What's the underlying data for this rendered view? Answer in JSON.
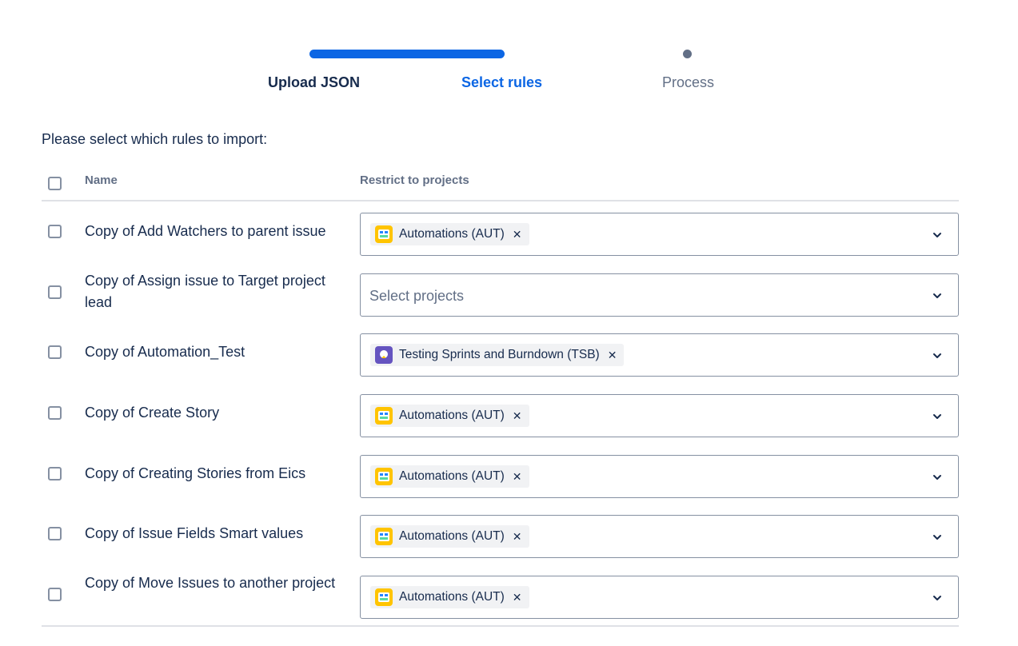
{
  "tracker": {
    "steps": [
      {
        "label": "Upload JSON",
        "state": "complete"
      },
      {
        "label": "Select rules",
        "state": "current"
      },
      {
        "label": "Process",
        "state": "upcoming"
      }
    ],
    "accent_color": "#0c66e4",
    "pending_color": "#626f86"
  },
  "instruction": "Please select which rules to import:",
  "table": {
    "headers": {
      "name": "Name",
      "restrict": "Restrict to projects"
    },
    "select_all_checked": false,
    "placeholder": "Select projects",
    "rows": [
      {
        "name": "Copy of Add Watchers to parent issue",
        "checked": false,
        "project": "Automations (AUT)",
        "project_icon": "automations-avatar-icon"
      },
      {
        "name": "Copy of Assign issue to Target project lead",
        "checked": false,
        "project": null,
        "project_icon": null
      },
      {
        "name": "Copy of Automation_Test",
        "checked": false,
        "project": "Testing Sprints and Burndown (TSB)",
        "project_icon": "tsb-avatar-icon"
      },
      {
        "name": "Copy of Create Story",
        "checked": false,
        "project": "Automations (AUT)",
        "project_icon": "automations-avatar-icon"
      },
      {
        "name": "Copy of Creating Stories from Eics",
        "checked": false,
        "project": "Automations (AUT)",
        "project_icon": "automations-avatar-icon"
      },
      {
        "name": "Copy of Issue Fields Smart values",
        "checked": false,
        "project": "Automations (AUT)",
        "project_icon": "automations-avatar-icon"
      },
      {
        "name": "Copy of Move Issues to another project",
        "checked": false,
        "project": "Automations (AUT)",
        "project_icon": "automations-avatar-icon"
      }
    ],
    "remove_glyph": "✕"
  }
}
